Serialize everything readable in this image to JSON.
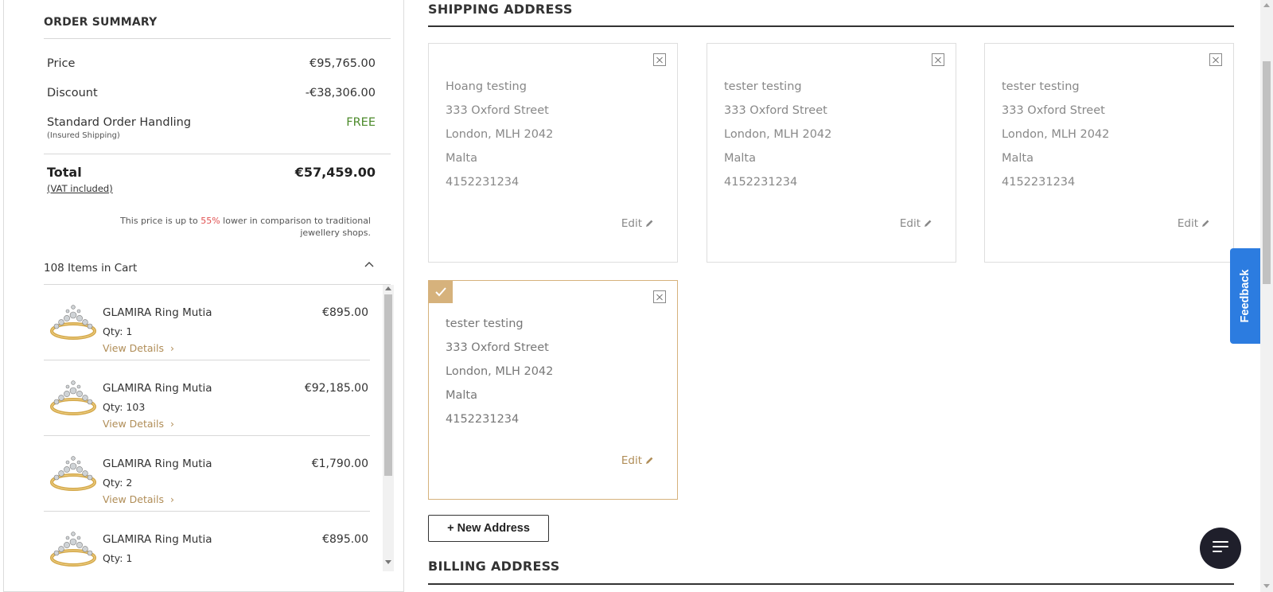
{
  "order_summary": {
    "title": "ORDER SUMMARY",
    "price_label": "Price",
    "price_value": "€95,765.00",
    "discount_label": "Discount",
    "discount_value": "-€38,306.00",
    "shipping_label": "Standard Order Handling",
    "shipping_note": "(Insured Shipping)",
    "shipping_value": "FREE",
    "total_label": "Total",
    "total_value": "€57,459.00",
    "vat_note": "(VAT included)",
    "compare_prefix": "This price is up to ",
    "compare_pct": "55%",
    "compare_suffix": " lower in comparison to traditional jewellery shops."
  },
  "cart": {
    "header": "108 Items in Cart",
    "details_label": "View Details",
    "items": [
      {
        "name": "GLAMIRA Ring Mutia",
        "price": "€895.00",
        "qty": "Qty: 1"
      },
      {
        "name": "GLAMIRA Ring Mutia",
        "price": "€92,185.00",
        "qty": "Qty: 103"
      },
      {
        "name": "GLAMIRA Ring Mutia",
        "price": "€1,790.00",
        "qty": "Qty: 2"
      },
      {
        "name": "GLAMIRA Ring Mutia",
        "price": "€895.00",
        "qty": "Qty: 1"
      }
    ]
  },
  "shipping": {
    "title": "SHIPPING ADDRESS",
    "edit_label": "Edit",
    "addresses": [
      {
        "name": "Hoang testing",
        "street": "333 Oxford Street",
        "city": "London, MLH 2042",
        "country": "Malta",
        "phone": "4152231234"
      },
      {
        "name": "tester testing",
        "street": "333 Oxford Street",
        "city": "London, MLH 2042",
        "country": "Malta",
        "phone": "4152231234"
      },
      {
        "name": "tester testing",
        "street": "333 Oxford Street",
        "city": "London, MLH 2042",
        "country": "Malta",
        "phone": "4152231234"
      },
      {
        "name": "tester testing",
        "street": "333 Oxford Street",
        "city": "London, MLH 2042",
        "country": "Malta",
        "phone": "4152231234"
      }
    ],
    "new_address_label": "+ New Address"
  },
  "billing": {
    "title": "BILLING ADDRESS"
  },
  "feedback": {
    "label": "Feedback"
  },
  "colors": {
    "accent_gold": "#d6b27c",
    "feedback_blue": "#2c7ce0",
    "free_green": "#4b8a2a",
    "discount_red": "#e05050"
  }
}
